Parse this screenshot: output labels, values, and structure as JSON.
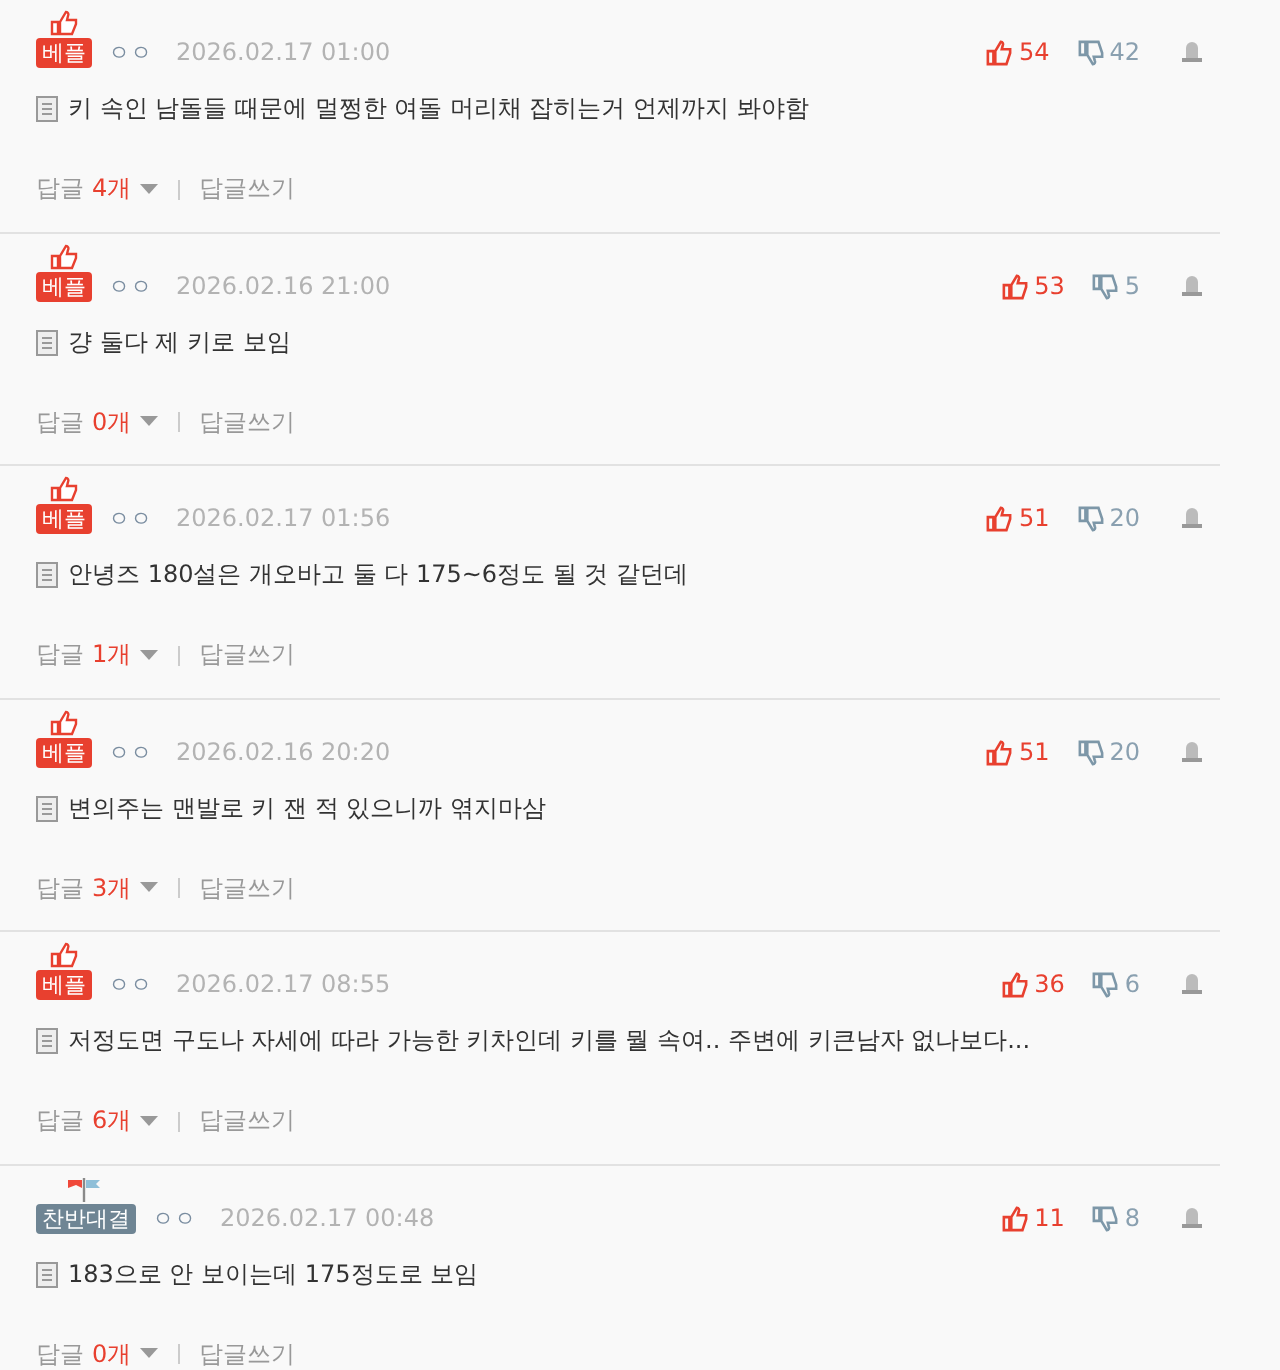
{
  "comments": [
    {
      "badge": {
        "kind": "best",
        "label": "베플"
      },
      "author": "ㅇㅇ",
      "date": "2026.02.17 01:00",
      "likes": "54",
      "dislikes": "42",
      "text": "키 속인 남돌들 때문에 멀쩡한 여돌 머리채 잡히는거 언제까지 봐야함",
      "reply_label": "답글",
      "reply_count": "4개",
      "write_reply": "답글쓰기"
    },
    {
      "badge": {
        "kind": "best",
        "label": "베플"
      },
      "author": "ㅇㅇ",
      "date": "2026.02.16 21:00",
      "likes": "53",
      "dislikes": "5",
      "text": "걍 둘다 제 키로 보임",
      "reply_label": "답글",
      "reply_count": "0개",
      "write_reply": "답글쓰기"
    },
    {
      "badge": {
        "kind": "best",
        "label": "베플"
      },
      "author": "ㅇㅇ",
      "date": "2026.02.17 01:56",
      "likes": "51",
      "dislikes": "20",
      "text": "안녕즈 180설은 개오바고 둘 다 175~6정도 될 것 같던데",
      "reply_label": "답글",
      "reply_count": "1개",
      "write_reply": "답글쓰기"
    },
    {
      "badge": {
        "kind": "best",
        "label": "베플"
      },
      "author": "ㅇㅇ",
      "date": "2026.02.16 20:20",
      "likes": "51",
      "dislikes": "20",
      "text": "변의주는 맨발로 키 잰 적 있으니까 엮지마삼",
      "reply_label": "답글",
      "reply_count": "3개",
      "write_reply": "답글쓰기"
    },
    {
      "badge": {
        "kind": "best",
        "label": "베플"
      },
      "author": "ㅇㅇ",
      "date": "2026.02.17 08:55",
      "likes": "36",
      "dislikes": "6",
      "text": "저정도면 구도나 자세에 따라 가능한 키차인데 키를 뭘 속여.. 주변에 키큰남자 없나보다...",
      "reply_label": "답글",
      "reply_count": "6개",
      "write_reply": "답글쓰기"
    },
    {
      "badge": {
        "kind": "debate",
        "label": "찬반대결"
      },
      "author": "ㅇㅇ",
      "date": "2026.02.17 00:48",
      "likes": "11",
      "dislikes": "8",
      "text": "183으로 안 보이는데 175정도로 보임",
      "reply_label": "답글",
      "reply_count": "0개",
      "write_reply": "답글쓰기"
    }
  ]
}
